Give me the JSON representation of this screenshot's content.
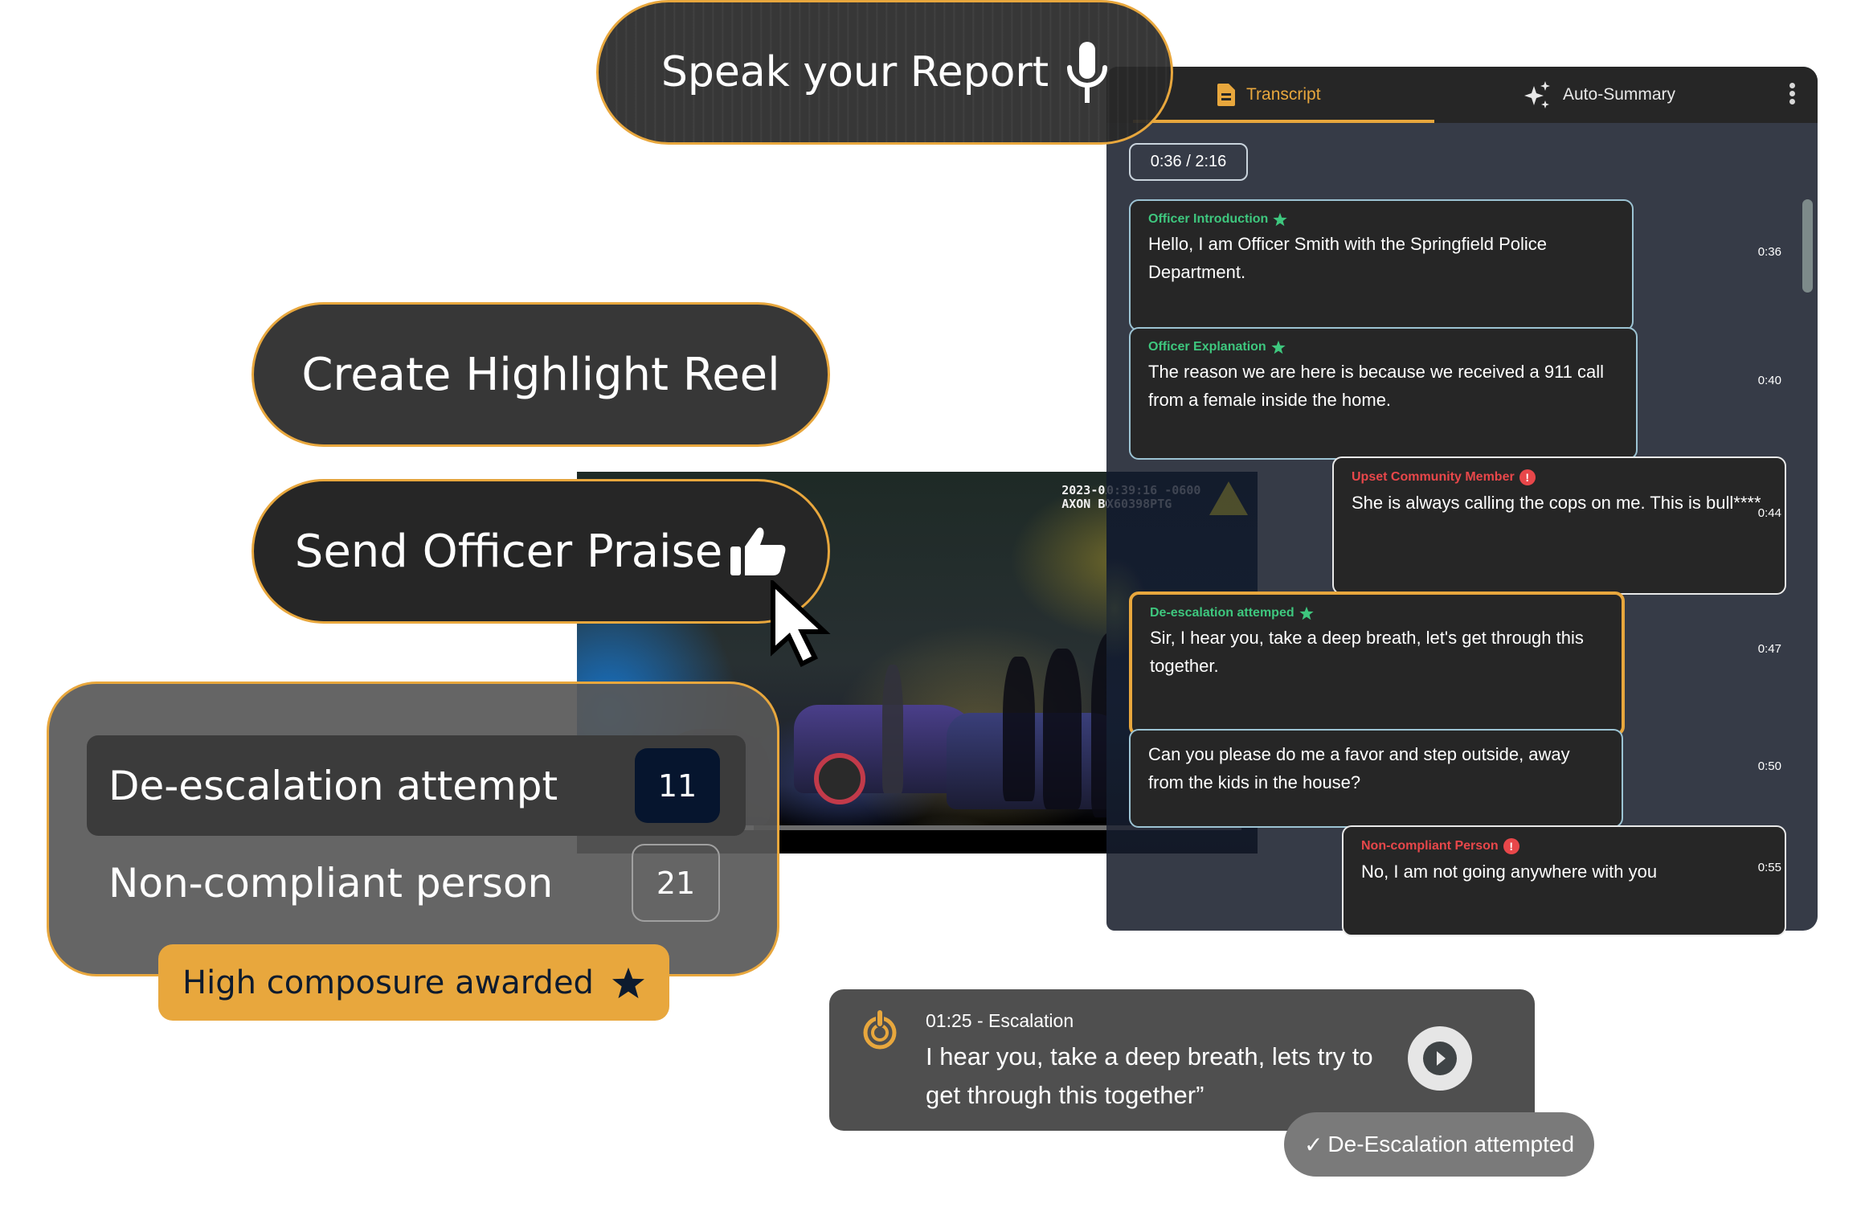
{
  "speak_report": {
    "label": "Speak your Report",
    "icon": "microphone-icon"
  },
  "highlight_reel": {
    "label": "Create Highlight Reel"
  },
  "officer_praise": {
    "label": "Send Officer Praise",
    "icon": "thumbs-up-icon"
  },
  "video": {
    "overlay_line1": "2023-01-07 20:39:16 -0600",
    "overlay_line2": "AXON BODY 3 X60398PTG",
    "progress_fraction": 0.26
  },
  "transcript_panel": {
    "tabs": [
      {
        "label": "Transcript",
        "icon": "document-icon",
        "active": true
      },
      {
        "label": "Auto-Summary",
        "icon": "sparkle-icon",
        "active": false
      }
    ],
    "more_icon": "more-vertical-icon",
    "playback_time": "0:36 / 2:16",
    "messages": [
      {
        "tag": "Officer Introduction",
        "tag_type": "positive",
        "text": "Hello, I am Officer Smith with the Springfield Police Department.",
        "time": "0:36",
        "side": "left"
      },
      {
        "tag": "Officer Explanation",
        "tag_type": "positive",
        "text": "The reason we are here is because we received a 911 call from a female inside the home.",
        "time": "0:40",
        "side": "left"
      },
      {
        "tag": "Upset Community Member",
        "tag_type": "negative",
        "text": "She is always calling the cops on me. This is bull****",
        "time": "0:44",
        "side": "right"
      },
      {
        "tag": "De-escalation attemped",
        "tag_type": "positive",
        "text": "Sir, I hear you, take a deep breath, let's get through this together.",
        "time": "0:47",
        "side": "left",
        "active": true
      },
      {
        "tag": "",
        "tag_type": "none",
        "text": "Can you please do me a favor and step outside, away from the kids in the house?",
        "time": "0:50",
        "side": "left"
      },
      {
        "tag": "Non-compliant Person",
        "tag_type": "negative",
        "text": "No,  I am not going anywhere with you",
        "time": "0:55",
        "side": "right"
      }
    ]
  },
  "tag_summary": {
    "rows": [
      {
        "label": "De-escalation attempt",
        "count": "11",
        "selected": true
      },
      {
        "label": "Non-compliant person",
        "count": "21",
        "selected": false
      }
    ],
    "award": {
      "label": "High composure awarded",
      "icon": "star-icon"
    }
  },
  "escalation_card": {
    "title": "01:25 - Escalation",
    "quote": "I hear you, take a deep breath, lets try to get through this together”",
    "icon": "alert-target-icon",
    "play_icon": "play-icon",
    "badge": {
      "check": "✓",
      "label": "De-Escalation attempted"
    }
  },
  "colors": {
    "accent": "#e8a73d",
    "positive": "#3ec77e",
    "negative": "#e8474a",
    "panel_bg": "#363b47",
    "card_bg": "#262626",
    "count_badge": "#06152e"
  }
}
